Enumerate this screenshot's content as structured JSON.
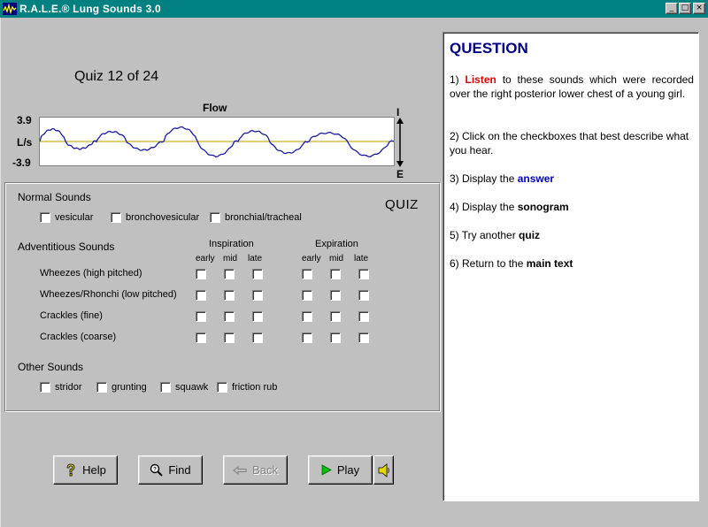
{
  "window": {
    "title": "R.A.L.E.® Lung Sounds 3.0",
    "minimize": "_",
    "maximize": "□",
    "close": "×"
  },
  "quiz": {
    "counter": "Quiz 12 of 24",
    "heading": "QUIZ"
  },
  "flow_chart": {
    "title": "Flow",
    "y_max_label": "3.9",
    "y_unit_label": "L/s",
    "y_min_label": "-3.9",
    "inspiration_label": "I",
    "expiration_label": "E",
    "line_color": "#1a1aa0",
    "baseline_color": "#b8a000",
    "ylim": [
      -3.9,
      3.9
    ],
    "cycles": [
      {
        "start": 0.0,
        "peak": 2.0,
        "trough": -1.2
      },
      {
        "start": 0.16,
        "peak": 1.6,
        "trough": -1.4
      },
      {
        "start": 0.35,
        "peak": 2.3,
        "trough": -2.4
      },
      {
        "start": 0.56,
        "peak": 1.7,
        "trough": -1.9
      },
      {
        "start": 0.76,
        "peak": 1.4,
        "trough": -2.4
      }
    ]
  },
  "normal_sounds": {
    "label": "Normal Sounds",
    "options": [
      "vesicular",
      "bronchovesicular",
      "bronchial/tracheal"
    ]
  },
  "adventitious_sounds": {
    "label": "Adventitious Sounds",
    "inspiration": "Inspiration",
    "expiration": "Expiration",
    "phases": [
      "early",
      "mid",
      "late"
    ],
    "rows": [
      "Wheezes (high pitched)",
      "Wheezes/Rhonchi (low pitched)",
      "Crackles (fine)",
      "Crackles (coarse)"
    ]
  },
  "other_sounds": {
    "label": "Other Sounds",
    "options": [
      "stridor",
      "grunting",
      "squawk",
      "friction rub"
    ]
  },
  "buttons": {
    "help": "Help",
    "find": "Find",
    "back": "Back",
    "play": "Play"
  },
  "question": {
    "title": "QUESTION",
    "item1_pre": "1) ",
    "item1_kw": "Listen",
    "item1_post": " to these sounds which were recorded over the right posterior lower chest of a young girl.",
    "item2": "2) Click on the checkboxes that best describe what you hear.",
    "item3_pre": "3) Display the ",
    "item3_kw": "answer",
    "item4_pre": "4) Display the ",
    "item4_kw": "sonogram",
    "item5_pre": "5) Try another ",
    "item5_kw": "quiz",
    "item6_pre": "6) Return to the ",
    "item6_kw": "main text"
  },
  "colors": {
    "titlebar": "#008080",
    "question_title": "#000080",
    "listen": "#e00000",
    "answer": "#0000c0"
  }
}
